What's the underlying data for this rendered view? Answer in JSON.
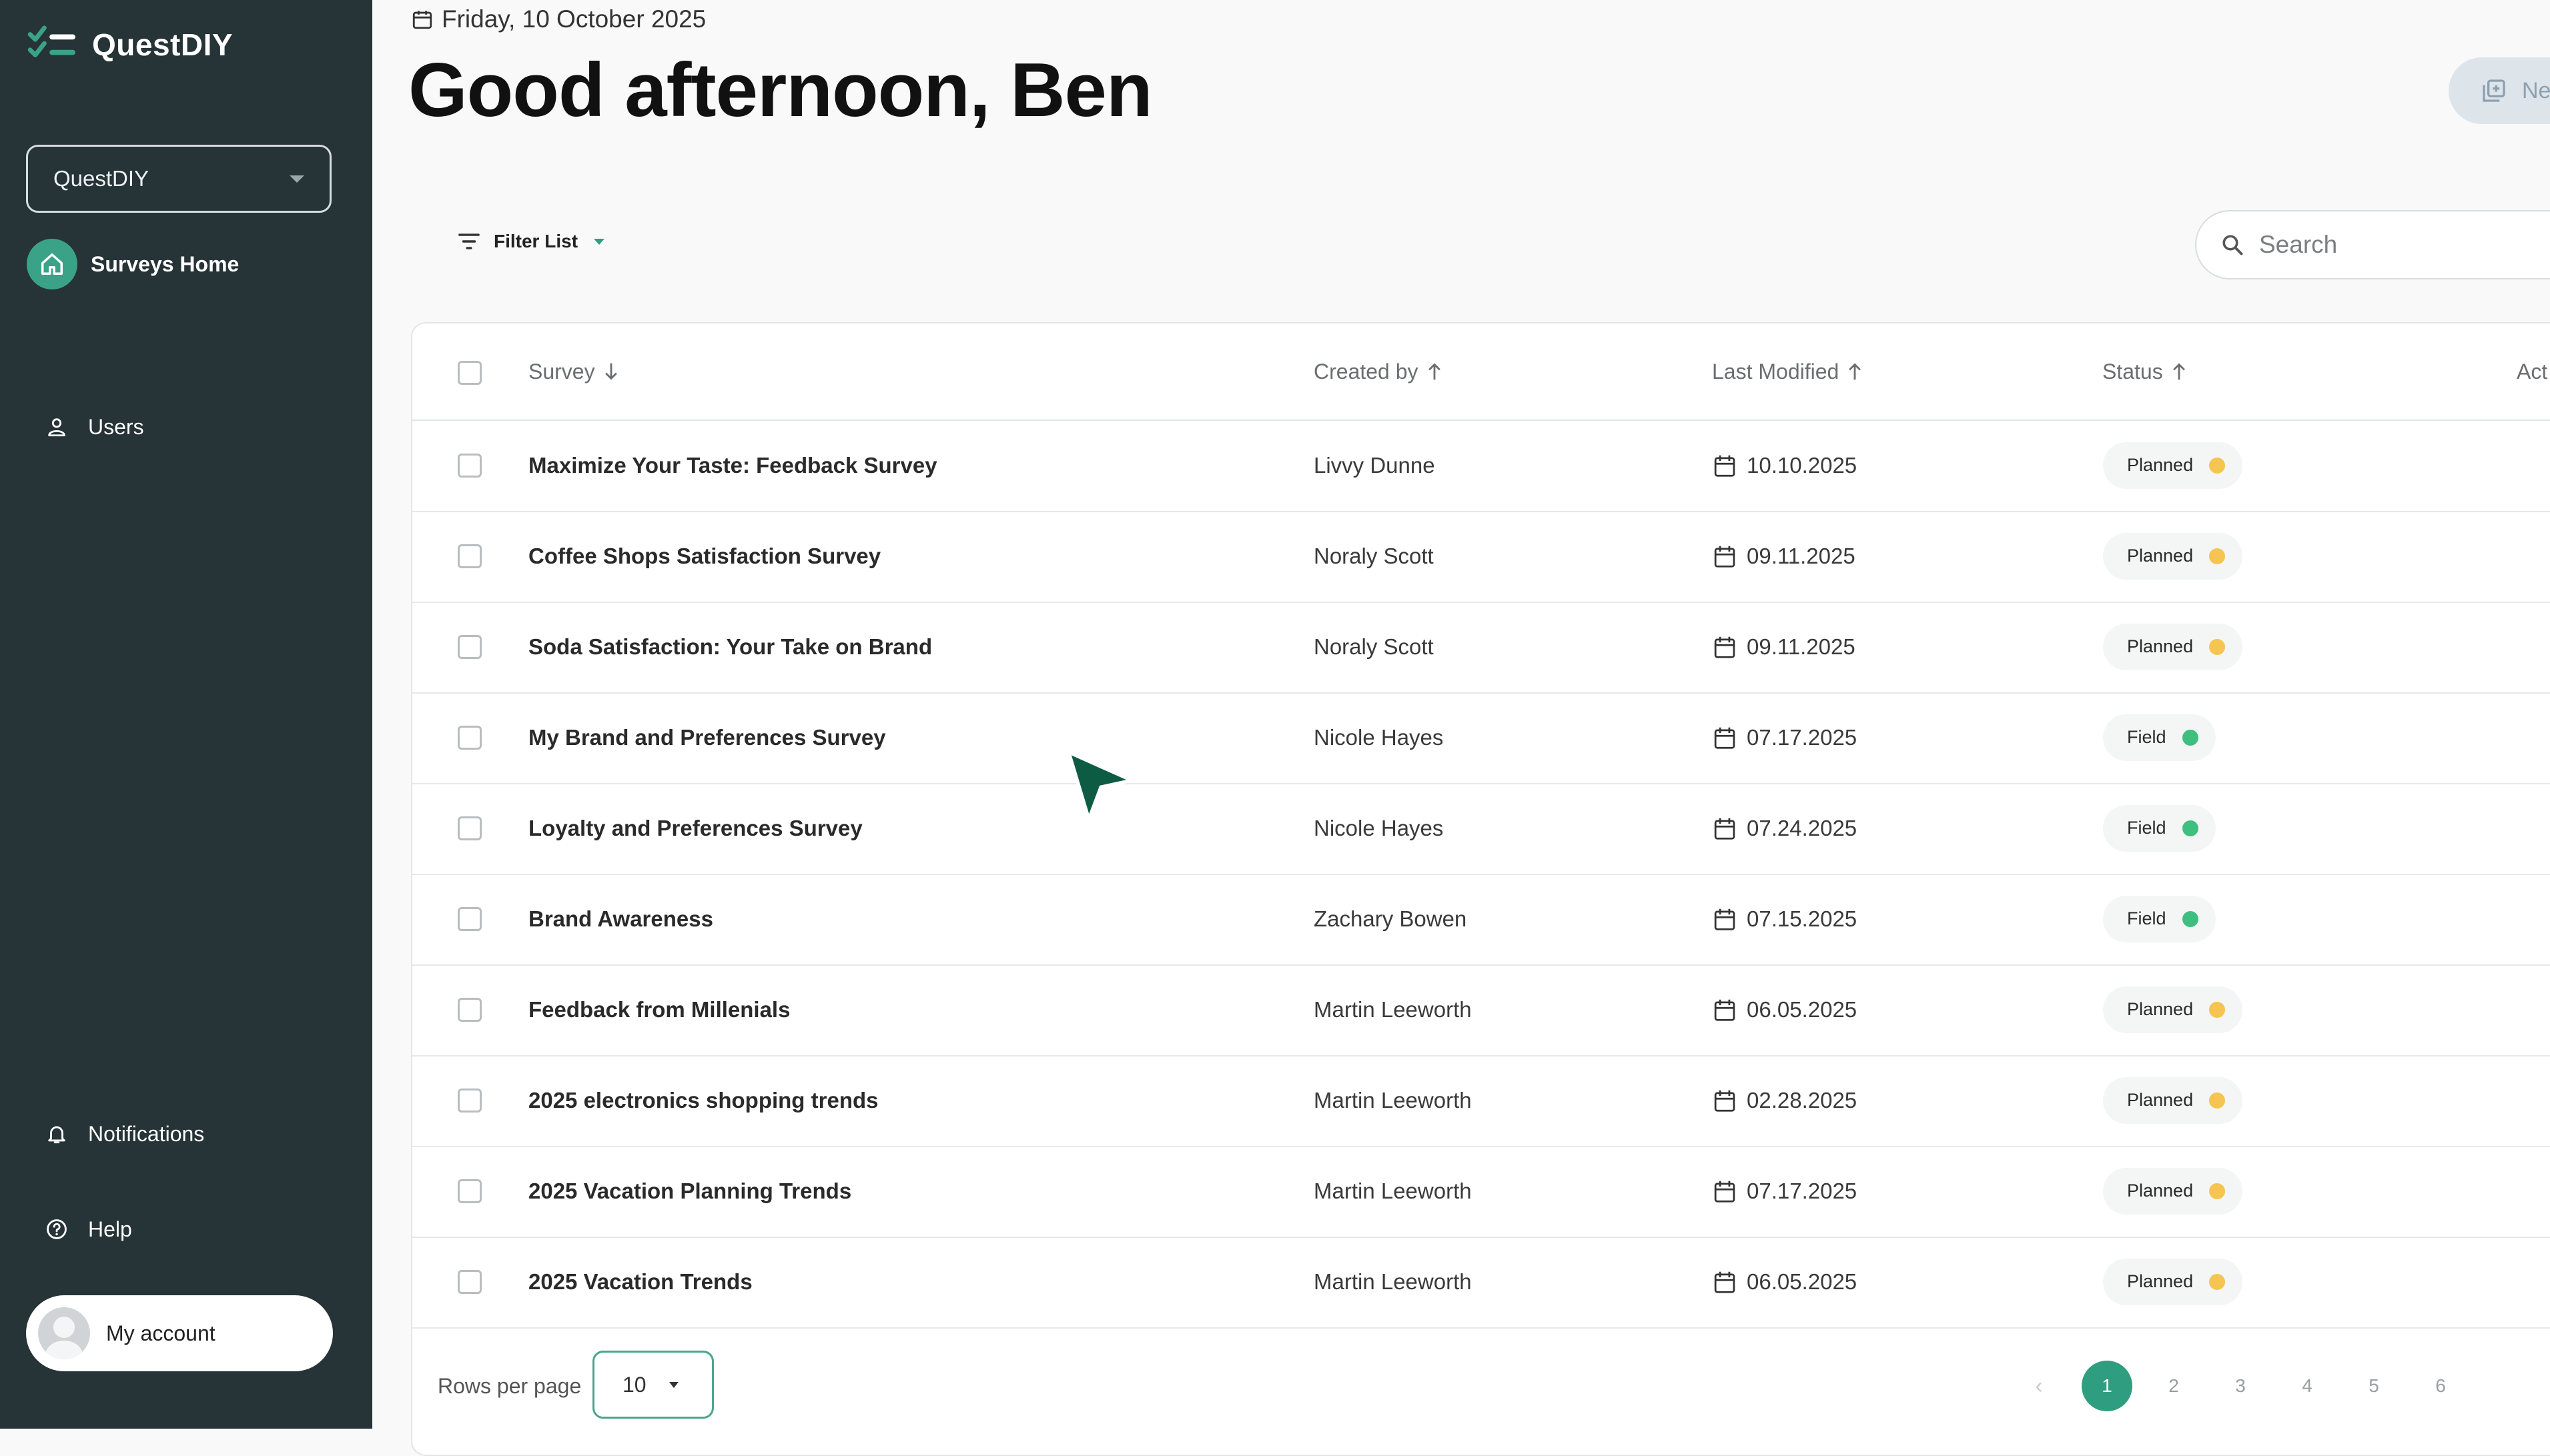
{
  "app": {
    "name": "QuestDIY"
  },
  "sidebar": {
    "workspace": "QuestDIY",
    "nav": {
      "home": "Surveys Home",
      "users": "Users",
      "notifications": "Notifications",
      "help": "Help"
    },
    "account": "My account"
  },
  "header": {
    "date": "Friday, 10 October 2025",
    "greeting": "Good afternoon, Ben",
    "new_button": "Ne"
  },
  "toolbar": {
    "filter_label": "Filter List",
    "search_placeholder": "Search"
  },
  "table": {
    "columns": {
      "survey": "Survey",
      "created_by": "Created by",
      "last_modified": "Last Modified",
      "status": "Status",
      "actions": "Act"
    },
    "rows": [
      {
        "survey": "Maximize Your Taste: Feedback Survey",
        "created_by": "Livvy Dunne",
        "modified": "10.10.2025",
        "status": "Planned"
      },
      {
        "survey": "Coffee Shops Satisfaction Survey",
        "created_by": "Noraly Scott",
        "modified": "09.11.2025",
        "status": "Planned"
      },
      {
        "survey": "Soda Satisfaction: Your Take on Brand",
        "created_by": "Noraly Scott",
        "modified": "09.11.2025",
        "status": "Planned"
      },
      {
        "survey": "My Brand and Preferences Survey",
        "created_by": "Nicole Hayes",
        "modified": "07.17.2025",
        "status": "Field"
      },
      {
        "survey": "Loyalty and Preferences Survey",
        "created_by": "Nicole Hayes",
        "modified": "07.24.2025",
        "status": "Field"
      },
      {
        "survey": "Brand Awareness",
        "created_by": "Zachary Bowen",
        "modified": "07.15.2025",
        "status": "Field"
      },
      {
        "survey": "Feedback from Millenials",
        "created_by": "Martin Leeworth",
        "modified": "06.05.2025",
        "status": "Planned"
      },
      {
        "survey": "2025 electronics shopping trends",
        "created_by": "Martin Leeworth",
        "modified": "02.28.2025",
        "status": "Planned"
      },
      {
        "survey": "2025 Vacation Planning Trends",
        "created_by": "Martin Leeworth",
        "modified": "07.17.2025",
        "status": "Planned"
      },
      {
        "survey": "2025 Vacation Trends",
        "created_by": "Martin Leeworth",
        "modified": "06.05.2025",
        "status": "Planned"
      }
    ]
  },
  "footer": {
    "rows_per_page_label": "Rows per page",
    "rows_per_page_value": "10",
    "pagination": {
      "prev": "‹",
      "pages": [
        "1",
        "2",
        "3",
        "4",
        "5",
        "6"
      ],
      "current": "1"
    }
  },
  "colors": {
    "sidebar": "#263337",
    "accent": "#2f9e80",
    "planned": "#f5c451",
    "field": "#3fbf7f"
  }
}
